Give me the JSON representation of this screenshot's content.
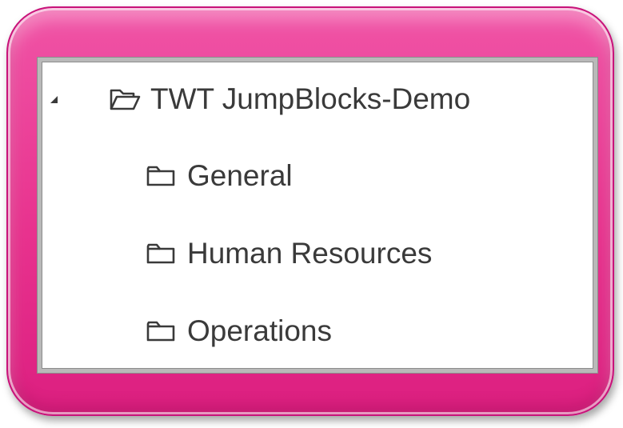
{
  "tree": {
    "root": {
      "label": "TWT JumpBlocks-Demo",
      "expanded": true,
      "expander_icon": "triangle-down-icon",
      "folder_icon": "folder-open-icon"
    },
    "children": [
      {
        "label": "General",
        "icon": "folder-icon"
      },
      {
        "label": "Human Resources",
        "icon": "folder-icon"
      },
      {
        "label": "Operations",
        "icon": "folder-icon"
      }
    ]
  },
  "colors": {
    "frame": "#e8328e",
    "panel_border": "#b9b9b9",
    "text": "#3a3a3a"
  }
}
